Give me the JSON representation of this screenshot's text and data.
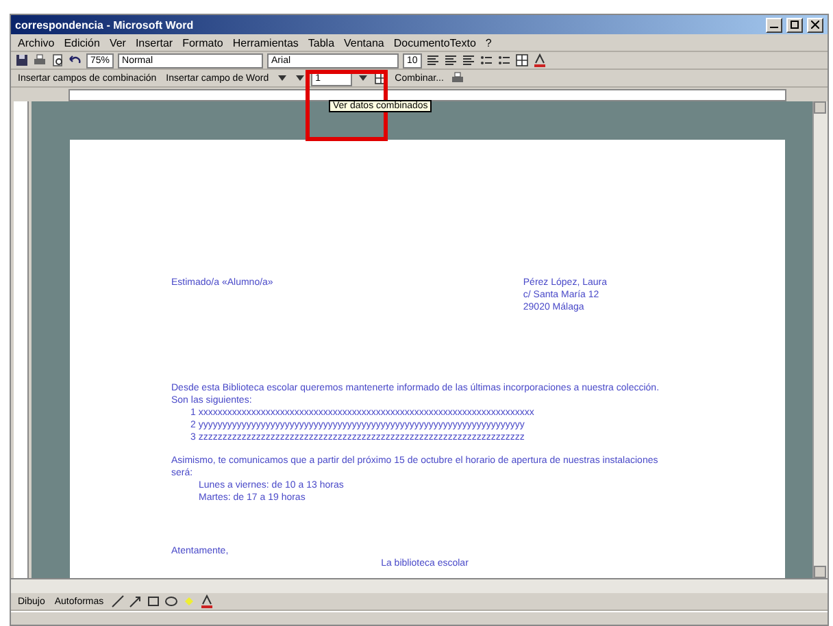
{
  "window": {
    "title": "correspondencia - Microsoft Word"
  },
  "menu": [
    "Archivo",
    "Edición",
    "Ver",
    "Insertar",
    "Formato",
    "Herramientas",
    "Tabla",
    "Ventana",
    "DocumentoTexto",
    "?"
  ],
  "toolbar": {
    "zoom": "75%",
    "style": "Normal",
    "font": "Arial",
    "size": "10"
  },
  "mail_merge": {
    "insert_fields": "Insertar campos de combinación",
    "insert_word_field": "Insertar campo de Word",
    "record": "1",
    "merge": "Combinar..."
  },
  "tooltip": "Ver datos combinados",
  "document": [
    {
      "kind": "greeting",
      "text": "Estimado/a «Alumno/a»",
      "address": [
        "Pérez López, Laura",
        "c/ Santa María 12",
        "29020 Málaga"
      ]
    },
    {
      "kind": "para",
      "text": "Desde esta Biblioteca escolar queremos mantenerte informado de las últimas incorporaciones a nuestra colección. Son las siguientes:"
    },
    {
      "kind": "item",
      "text": "1 xxxxxxxxxxxxxxxxxxxxxxxxxxxxxxxxxxxxxxxxxxxxxxxxxxxxxxxxxxxxxxxxxxxxxx"
    },
    {
      "kind": "item",
      "text": "2 yyyyyyyyyyyyyyyyyyyyyyyyyyyyyyyyyyyyyyyyyyyyyyyyyyyyyyyyyyyyyyyyyyyy"
    },
    {
      "kind": "item",
      "text": "3 zzzzzzzzzzzzzzzzzzzzzzzzzzzzzzzzzzzzzzzzzzzzzzzzzzzzzzzzzzzzzzzzzzzz"
    },
    {
      "kind": "para",
      "text": "Asimismo, te comunicamos que a partir del próximo 15 de octubre el horario de apertura de nuestras instalaciones será:"
    },
    {
      "kind": "indent",
      "text": "Lunes a viernes: de 10 a 13 horas"
    },
    {
      "kind": "indent",
      "text": "Martes: de 17 a 19 horas"
    },
    {
      "kind": "closing",
      "text": "Atentamente,"
    },
    {
      "kind": "signature",
      "text": "La biblioteca escolar"
    }
  ],
  "drawing_toolbar": {
    "draw": "Dibujo",
    "autoshapes": "Autoformas"
  }
}
